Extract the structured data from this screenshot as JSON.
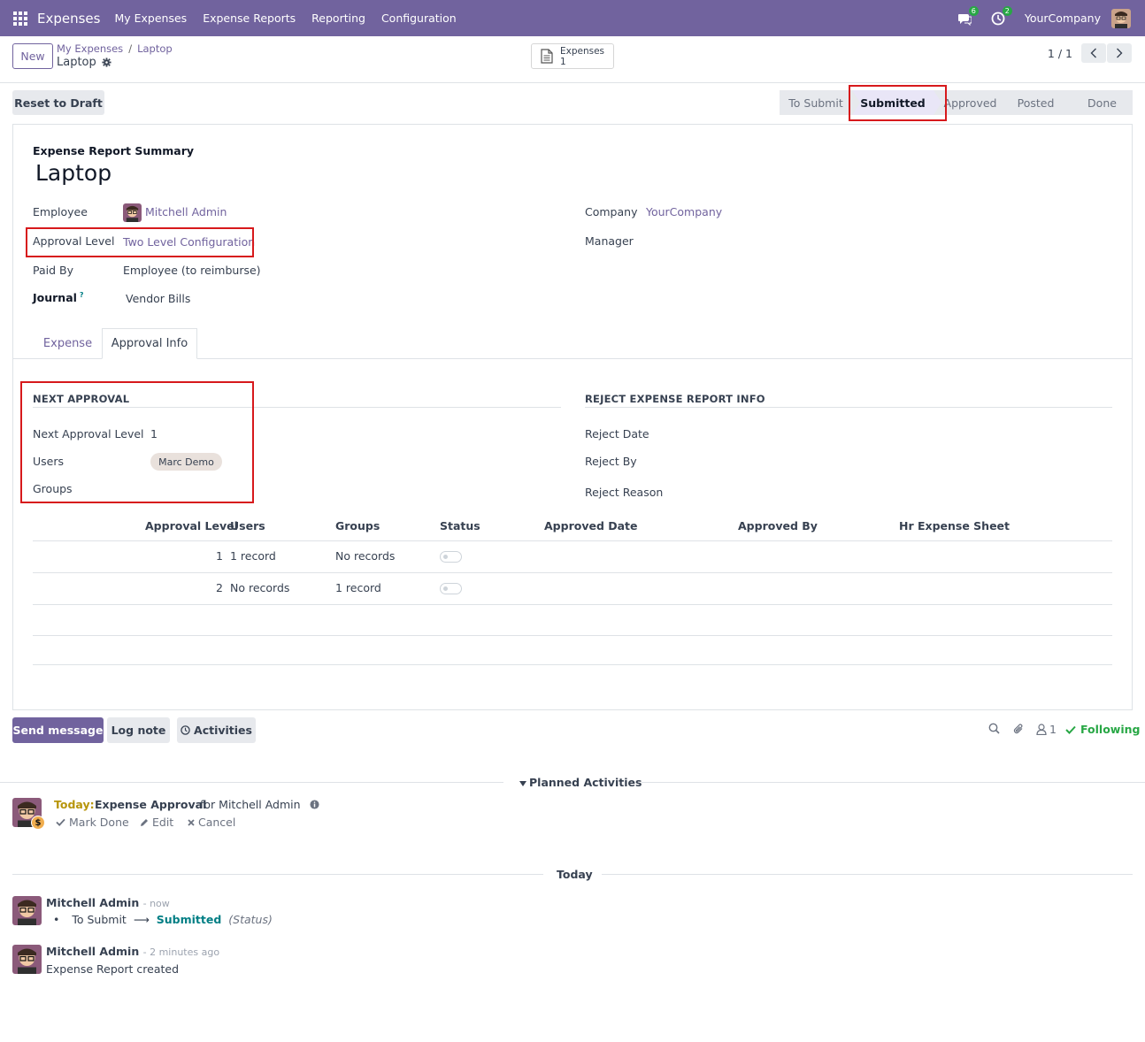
{
  "navbar": {
    "app_name": "Expenses",
    "menu": [
      "My Expenses",
      "Expense Reports",
      "Reporting",
      "Configuration"
    ],
    "messages_count": "6",
    "activities_count": "2",
    "company": "YourCompany"
  },
  "control_panel": {
    "new_label": "New",
    "breadcrumb_parent": "My Expenses",
    "breadcrumb_current": "Laptop",
    "record_title": "Laptop",
    "smart_button_label": "Expenses",
    "smart_button_count": "1",
    "pager": "1 / 1"
  },
  "actions": {
    "reset_label": "Reset to Draft"
  },
  "statusbar": {
    "stages": [
      "To Submit",
      "Submitted",
      "Approved",
      "Posted",
      "Done"
    ],
    "active": "Submitted"
  },
  "form": {
    "summary_label": "Expense Report Summary",
    "name": "Laptop",
    "employee_label": "Employee",
    "employee_value": "Mitchell Admin",
    "approval_level_label": "Approval Level",
    "approval_level_value": "Two Level Configuration",
    "paid_by_label": "Paid By",
    "paid_by_value": "Employee (to reimburse)",
    "journal_label": "Journal",
    "journal_help": "?",
    "journal_value": "Vendor Bills",
    "company_label": "Company",
    "company_value": "YourCompany",
    "manager_label": "Manager",
    "manager_value": ""
  },
  "tabs": [
    "Expense",
    "Approval Info"
  ],
  "next_approval": {
    "title": "NEXT APPROVAL",
    "level_label": "Next Approval Level",
    "level_value": "1",
    "users_label": "Users",
    "users_tag": "Marc Demo",
    "groups_label": "Groups"
  },
  "reject_info": {
    "title": "REJECT EXPENSE REPORT INFO",
    "date_label": "Reject Date",
    "by_label": "Reject By",
    "reason_label": "Reject Reason"
  },
  "approval_table": {
    "columns": [
      "Approval Level",
      "Users",
      "Groups",
      "Status",
      "Approved Date",
      "Approved By",
      "Hr Expense Sheet"
    ],
    "rows": [
      {
        "level": "1",
        "users": "1 record",
        "groups": "No records",
        "status_on": false
      },
      {
        "level": "2",
        "users": "No records",
        "groups": "1 record",
        "status_on": false
      }
    ]
  },
  "chatter": {
    "send_message": "Send message",
    "log_note": "Log note",
    "activities": "Activities",
    "followers_count": "1",
    "following": "Following",
    "planned_label": "Planned Activities",
    "activity": {
      "when": "Today:",
      "title": "Expense Approval",
      "for": "for Mitchell Admin",
      "mark_done": "Mark Done",
      "edit": "Edit",
      "cancel": "Cancel"
    },
    "today_label": "Today",
    "messages": [
      {
        "author": "Mitchell Admin",
        "time": "- now",
        "old": "To Submit",
        "new": "Submitted",
        "field": "(Status)"
      },
      {
        "author": "Mitchell Admin",
        "time": "- 2 minutes ago",
        "body": "Expense Report created"
      }
    ]
  },
  "colors": {
    "brand": "#71639e",
    "highlight": "#d7191c",
    "success": "#28a745",
    "today": "#b7950b"
  }
}
